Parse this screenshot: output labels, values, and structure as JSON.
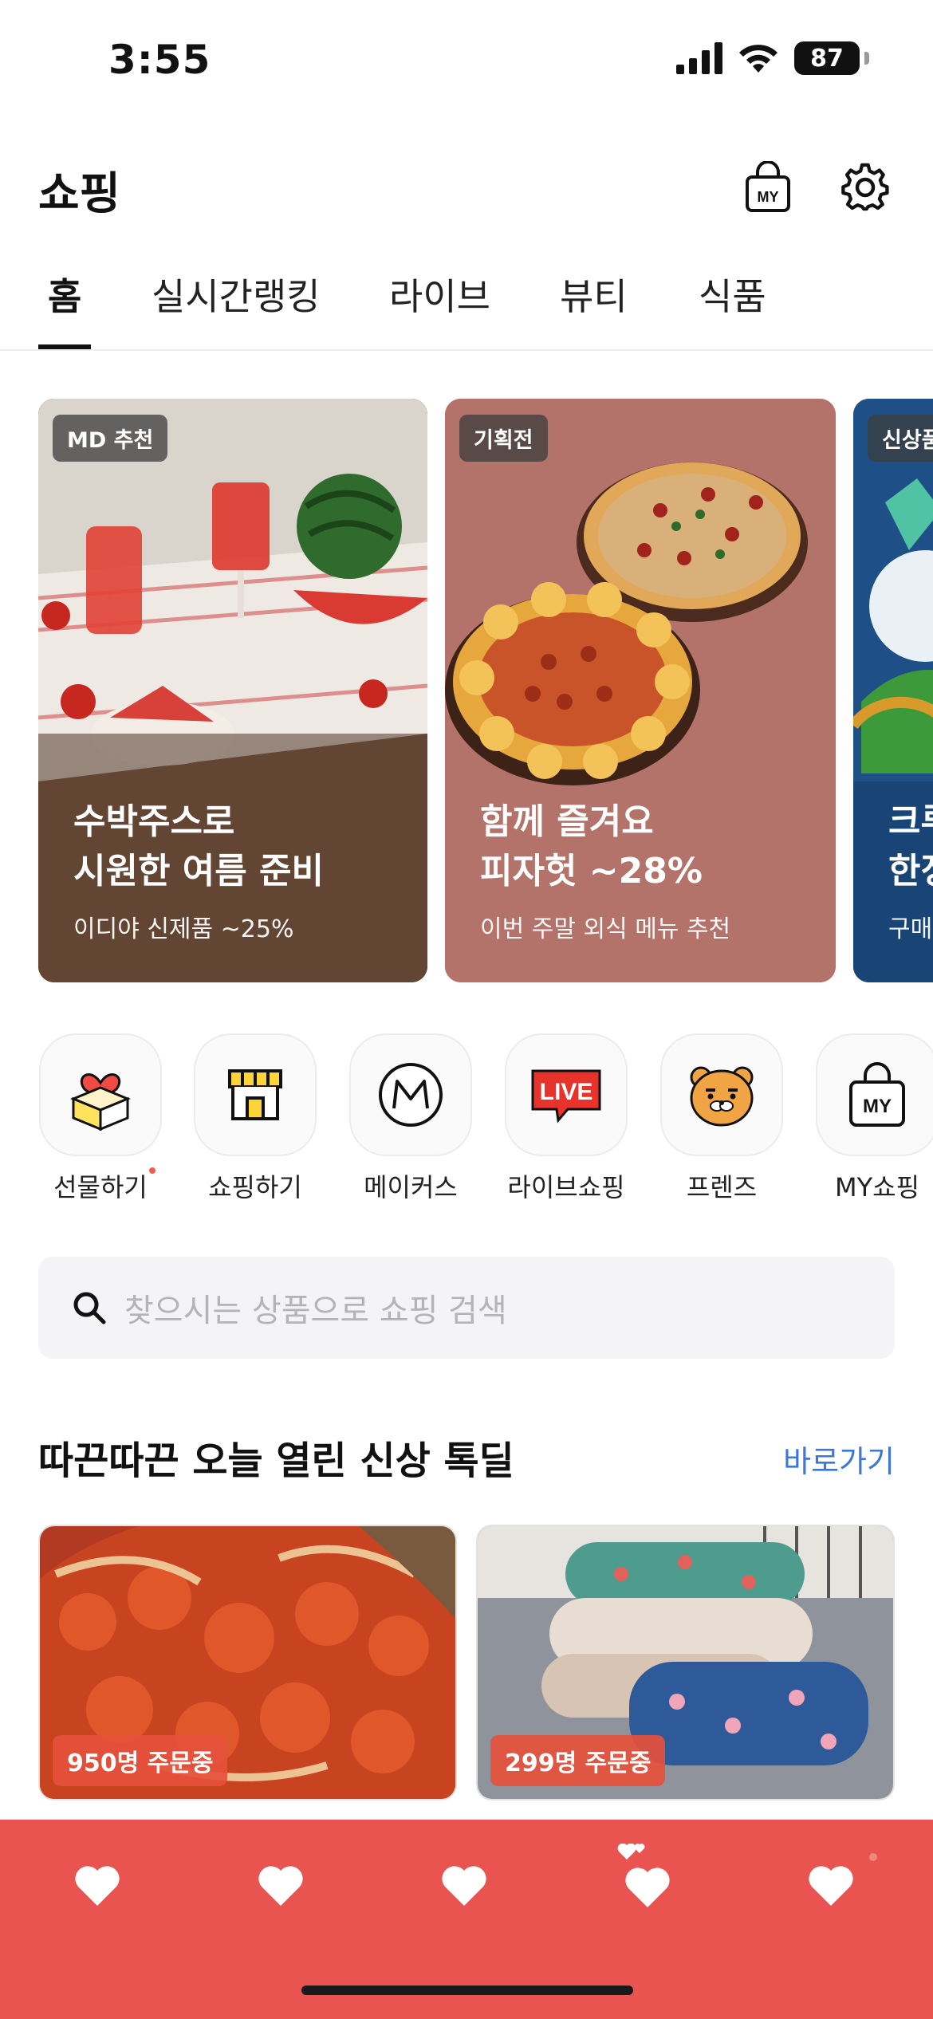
{
  "status": {
    "time": "3:55",
    "battery": "87"
  },
  "header": {
    "title": "쇼핑",
    "my_icon_text": "MY"
  },
  "tabs": [
    {
      "label": "홈",
      "active": true
    },
    {
      "label": "실시간랭킹",
      "active": false
    },
    {
      "label": "라이브",
      "active": false
    },
    {
      "label": "뷰티",
      "active": false
    },
    {
      "label": "식품",
      "active": false
    }
  ],
  "banners": [
    {
      "tag": "MD 추천",
      "title": "수박주스로\n시원한 여름 준비",
      "subtitle": "이디야 신제품 ~25%",
      "bg": "#6b4a36"
    },
    {
      "tag": "기획전",
      "title": "함께 즐겨요\n피자헛 ~28%",
      "subtitle": "이번 주말 외식 메뉴 추천",
      "bg": "#b4736a"
    },
    {
      "tag": "신상품",
      "title": "크루\n한정",
      "subtitle": "구매",
      "bg": "#1e4f86"
    }
  ],
  "shortcuts": [
    {
      "label": "선물하기",
      "icon": "gift-icon",
      "new_dot": true
    },
    {
      "label": "쇼핑하기",
      "icon": "store-icon",
      "new_dot": false
    },
    {
      "label": "메이커스",
      "icon": "makers-icon",
      "new_dot": false
    },
    {
      "label": "라이브쇼핑",
      "icon": "live-icon",
      "icon_text": "LIVE",
      "new_dot": false
    },
    {
      "label": "프렌즈",
      "icon": "ryan-face-icon",
      "new_dot": false
    },
    {
      "label": "MY쇼핑",
      "icon": "my-bag-icon",
      "icon_text": "MY",
      "new_dot": false
    }
  ],
  "search": {
    "placeholder": "찾으시는 상품으로 쇼핑 검색"
  },
  "deal_section": {
    "title": "따끈따끈 오늘 열린 신상 톡딜",
    "link": "바로가기",
    "products": [
      {
        "order_badge": "950명 주문중",
        "image": "spicy-chicken-stirfry"
      },
      {
        "order_badge": "299명 주문중",
        "image": "floral-pillows"
      }
    ]
  },
  "bottom_bar": {
    "bg": "#ea5450",
    "icons": [
      "heart-icon",
      "heart-icon",
      "heart-icon",
      "hearts-icon",
      "heart-icon"
    ]
  },
  "colors": {
    "accent_link": "#3d78d8",
    "badge": "#e6503c",
    "notification_dot": "#f05c4e"
  }
}
